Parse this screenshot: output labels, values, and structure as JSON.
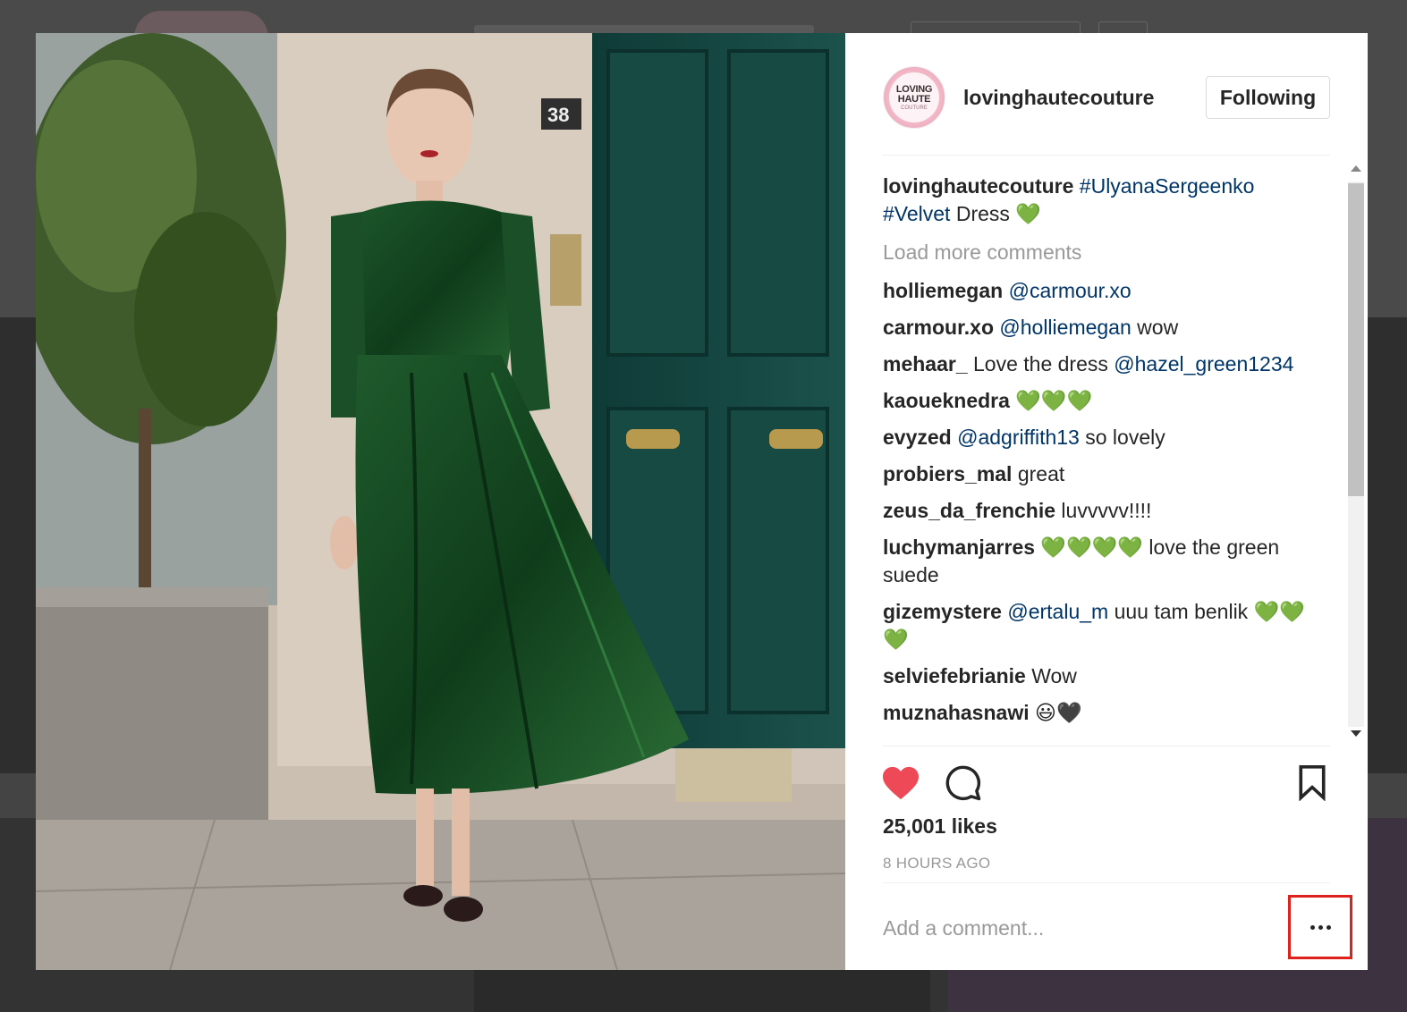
{
  "post": {
    "username": "lovinghautecouture",
    "avatar_text": [
      "LOVING",
      "HAUTE",
      "COUTURE"
    ],
    "follow_label": "Following",
    "caption": {
      "username": "lovinghautecouture",
      "hashtag1": "#UlyanaSergeenko",
      "hashtag2": "#Velvet",
      "text": " Dress "
    },
    "load_more": "Load more comments",
    "comments": [
      {
        "user": "holliemegan",
        "mention": "@carmour.xo",
        "text": ""
      },
      {
        "user": "carmour.xo",
        "mention": "@holliemegan",
        "text": " wow"
      },
      {
        "user": "mehaar_",
        "pre": " Love the dress ",
        "mention": "@hazel_green1234"
      },
      {
        "user": "kaoueknedra",
        "emoji": " 💚💚💚"
      },
      {
        "user": "evyzed",
        "mention": "@adgriffith13",
        "text": " so lovely"
      },
      {
        "user": "probiers_mal",
        "text": " great"
      },
      {
        "user": "zeus_da_frenchie",
        "text": " luvvvvv!!!!"
      },
      {
        "user": "luchymanjarres",
        "emoji": " 💚💚💚💚",
        "text": " love the green suede"
      },
      {
        "user": "gizemystere",
        "mention": "@ertalu_m",
        "text": " uuu tam benlik ",
        "emoji": "💚💚💚"
      },
      {
        "user": "selviefebrianie",
        "text": " Wow"
      },
      {
        "user": "muznahasnawi",
        "emoji": " 😃🖤"
      }
    ],
    "likes": "25,001 likes",
    "time_ago": "8 HOURS AGO",
    "comment_placeholder": "Add a comment...",
    "heart_emoji": "💚"
  },
  "icons": {
    "like": "heart-icon",
    "comment": "comment-bubble-icon",
    "save": "bookmark-icon",
    "more": "more-options-icon"
  },
  "colors": {
    "like_red": "#ed4956",
    "mention_blue": "#003569",
    "highlight_red": "#e0201a"
  }
}
